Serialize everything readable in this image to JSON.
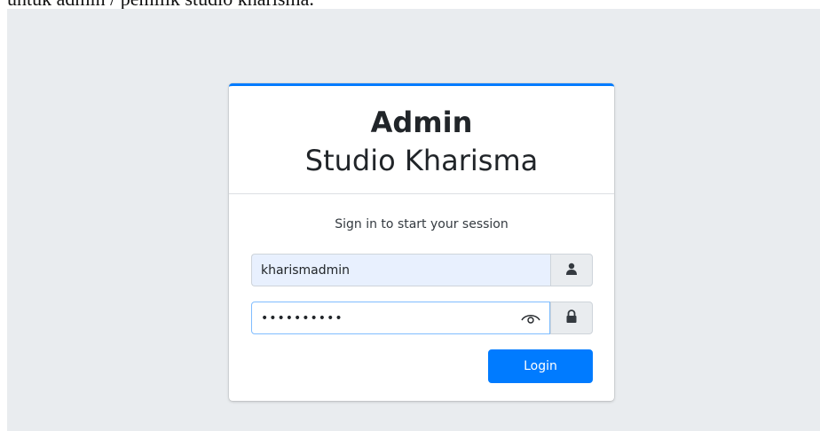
{
  "caption": "untuk admin / pemilik studio kharisma.",
  "card": {
    "brand_strong": "Admin",
    "brand_light": "Studio Kharisma",
    "message": "Sign in to start your session"
  },
  "form": {
    "username_value": "kharismadmin",
    "password_value": "••••••••••",
    "login_label": "Login"
  },
  "colors": {
    "accent": "#007bff",
    "background": "#e9ecef"
  },
  "icons": {
    "user": "user-icon",
    "lock": "lock-icon",
    "eye": "eye-icon"
  }
}
